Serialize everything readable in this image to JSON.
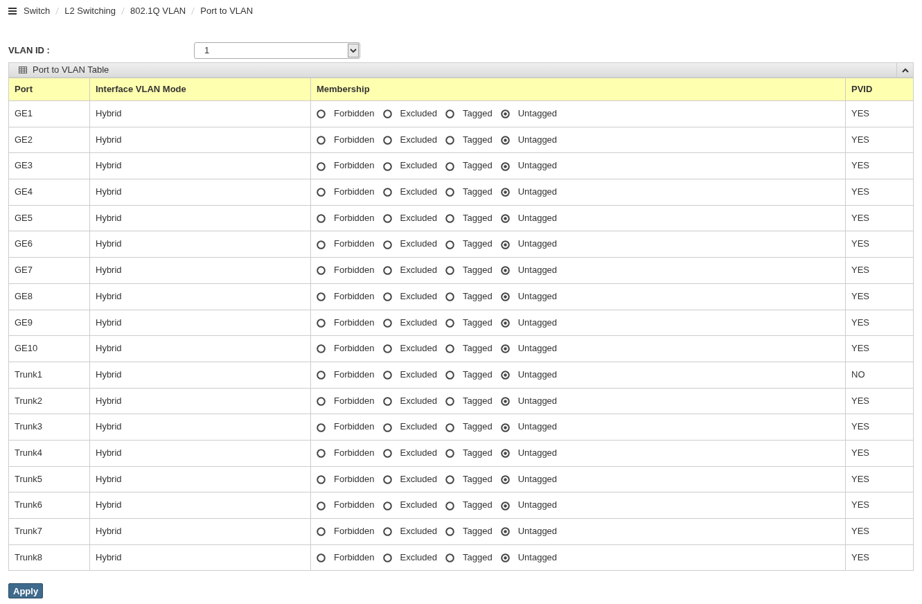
{
  "breadcrumb": [
    "Switch",
    "L2 Switching",
    "802.1Q VLAN",
    "Port to VLAN"
  ],
  "vlan_id": {
    "label": "VLAN ID :",
    "value": "1"
  },
  "panel": {
    "title": "Port to VLAN Table",
    "expanded": true
  },
  "table": {
    "columns": [
      "Port",
      "Interface VLAN Mode",
      "Membership",
      "PVID"
    ],
    "rows": [
      {
        "port": "GE1",
        "mode": "Hybrid",
        "membership": [
          {
            "label": "Forbidden",
            "selected": false
          },
          {
            "label": "Excluded",
            "selected": false
          },
          {
            "label": "Tagged",
            "selected": false
          },
          {
            "label": "Untagged",
            "selected": true
          }
        ],
        "pvid": "YES"
      },
      {
        "port": "GE2",
        "mode": "Hybrid",
        "membership": [
          {
            "label": "Forbidden",
            "selected": false
          },
          {
            "label": "Excluded",
            "selected": false
          },
          {
            "label": "Tagged",
            "selected": false
          },
          {
            "label": "Untagged",
            "selected": true
          }
        ],
        "pvid": "YES"
      },
      {
        "port": "GE3",
        "mode": "Hybrid",
        "membership": [
          {
            "label": "Forbidden",
            "selected": false
          },
          {
            "label": "Excluded",
            "selected": false
          },
          {
            "label": "Tagged",
            "selected": false
          },
          {
            "label": "Untagged",
            "selected": true
          }
        ],
        "pvid": "YES"
      },
      {
        "port": "GE4",
        "mode": "Hybrid",
        "membership": [
          {
            "label": "Forbidden",
            "selected": false
          },
          {
            "label": "Excluded",
            "selected": false
          },
          {
            "label": "Tagged",
            "selected": false
          },
          {
            "label": "Untagged",
            "selected": true
          }
        ],
        "pvid": "YES"
      },
      {
        "port": "GE5",
        "mode": "Hybrid",
        "membership": [
          {
            "label": "Forbidden",
            "selected": false
          },
          {
            "label": "Excluded",
            "selected": false
          },
          {
            "label": "Tagged",
            "selected": false
          },
          {
            "label": "Untagged",
            "selected": true
          }
        ],
        "pvid": "YES"
      },
      {
        "port": "GE6",
        "mode": "Hybrid",
        "membership": [
          {
            "label": "Forbidden",
            "selected": false
          },
          {
            "label": "Excluded",
            "selected": false
          },
          {
            "label": "Tagged",
            "selected": false
          },
          {
            "label": "Untagged",
            "selected": true
          }
        ],
        "pvid": "YES"
      },
      {
        "port": "GE7",
        "mode": "Hybrid",
        "membership": [
          {
            "label": "Forbidden",
            "selected": false
          },
          {
            "label": "Excluded",
            "selected": false
          },
          {
            "label": "Tagged",
            "selected": false
          },
          {
            "label": "Untagged",
            "selected": true
          }
        ],
        "pvid": "YES"
      },
      {
        "port": "GE8",
        "mode": "Hybrid",
        "membership": [
          {
            "label": "Forbidden",
            "selected": false
          },
          {
            "label": "Excluded",
            "selected": false
          },
          {
            "label": "Tagged",
            "selected": false
          },
          {
            "label": "Untagged",
            "selected": true
          }
        ],
        "pvid": "YES"
      },
      {
        "port": "GE9",
        "mode": "Hybrid",
        "membership": [
          {
            "label": "Forbidden",
            "selected": false
          },
          {
            "label": "Excluded",
            "selected": false
          },
          {
            "label": "Tagged",
            "selected": false
          },
          {
            "label": "Untagged",
            "selected": true
          }
        ],
        "pvid": "YES"
      },
      {
        "port": "GE10",
        "mode": "Hybrid",
        "membership": [
          {
            "label": "Forbidden",
            "selected": false
          },
          {
            "label": "Excluded",
            "selected": false
          },
          {
            "label": "Tagged",
            "selected": false
          },
          {
            "label": "Untagged",
            "selected": true
          }
        ],
        "pvid": "YES"
      },
      {
        "port": "Trunk1",
        "mode": "Hybrid",
        "membership": [
          {
            "label": "Forbidden",
            "selected": false
          },
          {
            "label": "Excluded",
            "selected": false
          },
          {
            "label": "Tagged",
            "selected": false
          },
          {
            "label": "Untagged",
            "selected": true
          }
        ],
        "pvid": "NO"
      },
      {
        "port": "Trunk2",
        "mode": "Hybrid",
        "membership": [
          {
            "label": "Forbidden",
            "selected": false
          },
          {
            "label": "Excluded",
            "selected": false
          },
          {
            "label": "Tagged",
            "selected": false
          },
          {
            "label": "Untagged",
            "selected": true
          }
        ],
        "pvid": "YES"
      },
      {
        "port": "Trunk3",
        "mode": "Hybrid",
        "membership": [
          {
            "label": "Forbidden",
            "selected": false
          },
          {
            "label": "Excluded",
            "selected": false
          },
          {
            "label": "Tagged",
            "selected": false
          },
          {
            "label": "Untagged",
            "selected": true
          }
        ],
        "pvid": "YES"
      },
      {
        "port": "Trunk4",
        "mode": "Hybrid",
        "membership": [
          {
            "label": "Forbidden",
            "selected": false
          },
          {
            "label": "Excluded",
            "selected": false
          },
          {
            "label": "Tagged",
            "selected": false
          },
          {
            "label": "Untagged",
            "selected": true
          }
        ],
        "pvid": "YES"
      },
      {
        "port": "Trunk5",
        "mode": "Hybrid",
        "membership": [
          {
            "label": "Forbidden",
            "selected": false
          },
          {
            "label": "Excluded",
            "selected": false
          },
          {
            "label": "Tagged",
            "selected": false
          },
          {
            "label": "Untagged",
            "selected": true
          }
        ],
        "pvid": "YES"
      },
      {
        "port": "Trunk6",
        "mode": "Hybrid",
        "membership": [
          {
            "label": "Forbidden",
            "selected": false
          },
          {
            "label": "Excluded",
            "selected": false
          },
          {
            "label": "Tagged",
            "selected": false
          },
          {
            "label": "Untagged",
            "selected": true
          }
        ],
        "pvid": "YES"
      },
      {
        "port": "Trunk7",
        "mode": "Hybrid",
        "membership": [
          {
            "label": "Forbidden",
            "selected": false
          },
          {
            "label": "Excluded",
            "selected": false
          },
          {
            "label": "Tagged",
            "selected": false
          },
          {
            "label": "Untagged",
            "selected": true
          }
        ],
        "pvid": "YES"
      },
      {
        "port": "Trunk8",
        "mode": "Hybrid",
        "membership": [
          {
            "label": "Forbidden",
            "selected": false
          },
          {
            "label": "Excluded",
            "selected": false
          },
          {
            "label": "Tagged",
            "selected": false
          },
          {
            "label": "Untagged",
            "selected": true
          }
        ],
        "pvid": "YES"
      }
    ]
  },
  "apply_button": "Apply"
}
